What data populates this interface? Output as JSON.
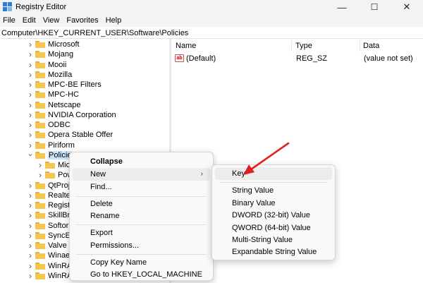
{
  "window": {
    "title": "Registry Editor",
    "minimize": "—",
    "maximize": "☐",
    "close": "✕"
  },
  "menubar": [
    "File",
    "Edit",
    "View",
    "Favorites",
    "Help"
  ],
  "address": "Computer\\HKEY_CURRENT_USER\\Software\\Policies",
  "tree": [
    {
      "label": "Microsoft",
      "expanded": false
    },
    {
      "label": "Mojang",
      "expanded": false
    },
    {
      "label": "Mooii",
      "expanded": false
    },
    {
      "label": "Mozilla",
      "expanded": false
    },
    {
      "label": "MPC-BE Filters",
      "expanded": false
    },
    {
      "label": "MPC-HC",
      "expanded": false
    },
    {
      "label": "Netscape",
      "expanded": false
    },
    {
      "label": "NVIDIA Corporation",
      "expanded": false
    },
    {
      "label": "ODBC",
      "expanded": false
    },
    {
      "label": "Opera Stable Offer",
      "expanded": false
    },
    {
      "label": "Piriform",
      "expanded": false
    },
    {
      "label": "Policie",
      "expanded": true
    },
    {
      "label": "Mic",
      "expanded": false,
      "child": true
    },
    {
      "label": "Pow",
      "expanded": false,
      "child": true
    },
    {
      "label": "QtProje",
      "expanded": false
    },
    {
      "label": "Realtek",
      "expanded": false
    },
    {
      "label": "Registe",
      "expanded": false
    },
    {
      "label": "SkillBra",
      "expanded": false
    },
    {
      "label": "Softori",
      "expanded": false
    },
    {
      "label": "SyncEn",
      "expanded": false
    },
    {
      "label": "Valve",
      "expanded": false
    },
    {
      "label": "Winaer",
      "expanded": false
    },
    {
      "label": "WinRA",
      "expanded": false
    },
    {
      "label": "WinRA",
      "expanded": false
    }
  ],
  "list": {
    "headers": {
      "name": "Name",
      "type": "Type",
      "data": "Data"
    },
    "rows": [
      {
        "name": "(Default)",
        "type": "REG_SZ",
        "data": "(value not set)"
      }
    ]
  },
  "context_menu": {
    "collapse": "Collapse",
    "new": "New",
    "find": "Find...",
    "delete": "Delete",
    "rename": "Rename",
    "export": "Export",
    "permissions": "Permissions...",
    "copy_key_name": "Copy Key Name",
    "goto": "Go to HKEY_LOCAL_MACHINE"
  },
  "submenu": {
    "key": "Key",
    "string": "String Value",
    "binary": "Binary Value",
    "dword": "DWORD (32-bit) Value",
    "qword": "QWORD (64-bit) Value",
    "multi": "Multi-String Value",
    "expandable": "Expandable String Value"
  },
  "colors": {
    "accent": "#2d7fd3",
    "selection": "#cce4f7",
    "annotation_arrow": "#e02020"
  }
}
